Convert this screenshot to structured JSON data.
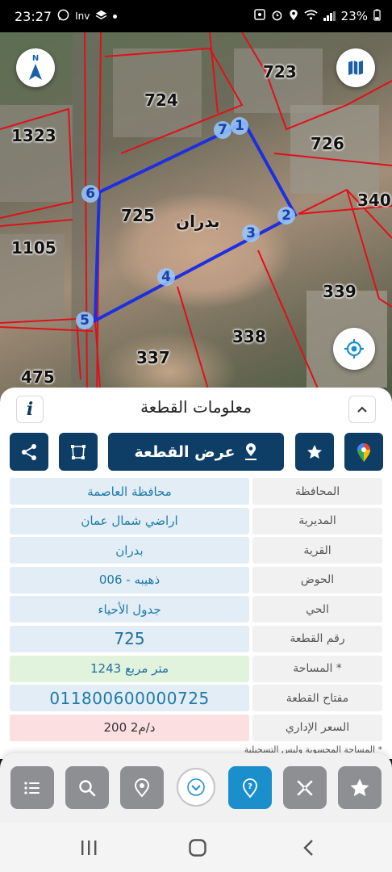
{
  "status_bar": {
    "time": "23:27",
    "battery": "23%",
    "left_icons": [
      "whatsapp-icon",
      "inv-app-icon",
      "layers-app-icon",
      "dot-icon"
    ],
    "inv_label": "Inv",
    "right_icons": [
      "photo-icon",
      "alarm-icon",
      "location-icon",
      "wifi-icon",
      "signal-icon"
    ]
  },
  "map": {
    "plot_numbers": {
      "p723": "723",
      "p724": "724",
      "p726": "726",
      "p1323": "1323",
      "p340": "340",
      "p725": "725",
      "p1105": "1105",
      "p339": "339",
      "p338": "338",
      "p337": "337",
      "p475": "475"
    },
    "village_label": "بدران",
    "vertices": [
      "1",
      "2",
      "3",
      "4",
      "5",
      "6",
      "7"
    ],
    "colors": {
      "selected_outline": "#1e2fe0",
      "parcel_lines": "#e0101a",
      "vertex_fill": "#96c8ff"
    }
  },
  "panel": {
    "title": "معلومات القطعة",
    "info_label": "i",
    "view_plot_label": "عرض القطعة",
    "rows": [
      {
        "label": "المحافظة",
        "value": "محافظة العاصمة"
      },
      {
        "label": "المديرية",
        "value": "اراضي شمال عمان"
      },
      {
        "label": "القرية",
        "value": "بدران"
      },
      {
        "label": "الحوض",
        "value": "ذهيبه - 006"
      },
      {
        "label": "الحي",
        "value": "جدول الأحياء"
      },
      {
        "label": "رقم القطعة",
        "value": "725"
      },
      {
        "label": "المساحة *",
        "value": "1243  متر مربع"
      },
      {
        "label": "مفتاح القطعة",
        "value": "011800600000725"
      },
      {
        "label": "السعر الإداري",
        "value": "200 د/م2"
      }
    ],
    "footnote": "* المساحة المحسوبة وليس التسجيلية",
    "colors": {
      "primary": "#0e3e66",
      "value_bg": "#e2edf6",
      "area_bg": "#e2f3dd",
      "price_bg": "#fbdfe1"
    }
  },
  "toolbar": {
    "buttons": [
      "list-icon",
      "search-icon",
      "location-pin-icon",
      "chevron-down-icon",
      "help-icon",
      "tools-icon",
      "star-icon"
    ],
    "active_color": "#1a8fcc"
  },
  "navbar": {
    "buttons": [
      "recent-apps-icon",
      "home-icon",
      "back-icon"
    ]
  }
}
